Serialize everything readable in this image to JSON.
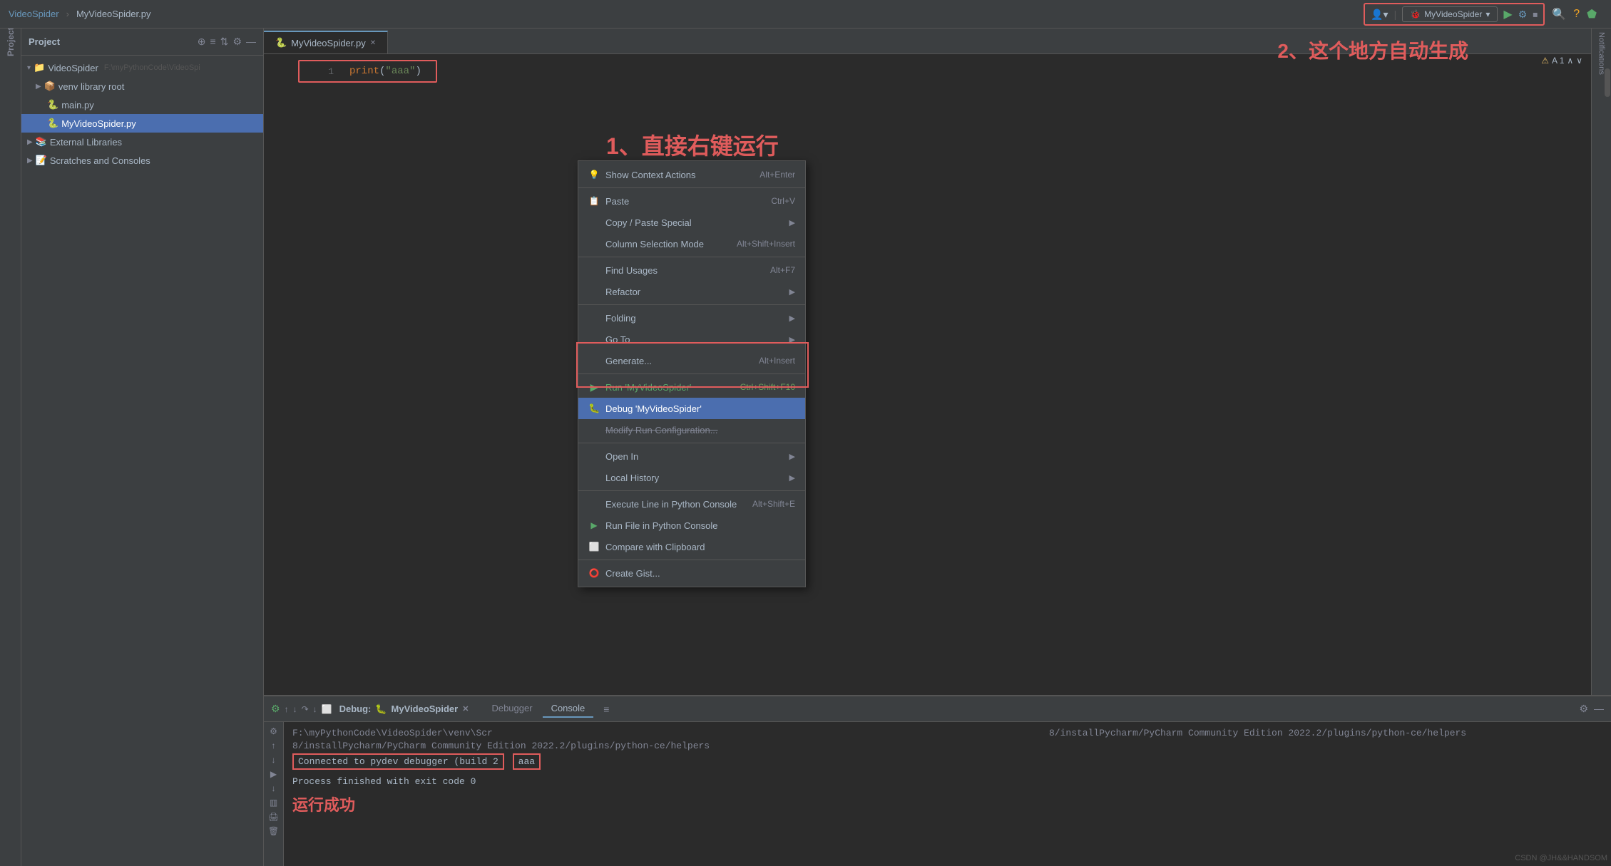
{
  "titlebar": {
    "project_name": "VideoSpider",
    "file_name": "MyVideoSpider.py",
    "run_config": "MyVideoSpider",
    "annotation_1": "1、直接右键运行",
    "annotation_2": "2、这个地方自动生成"
  },
  "sidebar": {
    "panel_title": "Project",
    "items": [
      {
        "label": "VideoSpider",
        "type": "folder",
        "indent": 0,
        "path": "F:\\myPythonCode\\VideoSpi"
      },
      {
        "label": "venv library root",
        "type": "venv",
        "indent": 1
      },
      {
        "label": "main.py",
        "type": "py",
        "indent": 2
      },
      {
        "label": "MyVideoSpider.py",
        "type": "py",
        "indent": 2,
        "selected": true
      },
      {
        "label": "External Libraries",
        "type": "folder",
        "indent": 0
      },
      {
        "label": "Scratches and Consoles",
        "type": "folder",
        "indent": 0
      }
    ]
  },
  "editor": {
    "tab_label": "MyVideoSpider.py",
    "code_line_1_num": "1",
    "code_line_1": "print(\"aaa\")"
  },
  "context_menu": {
    "items": [
      {
        "label": "Show Context Actions",
        "shortcut": "Alt+Enter",
        "icon": "💡",
        "has_arrow": false
      },
      {
        "label": "Paste",
        "shortcut": "Ctrl+V",
        "icon": "📋",
        "has_arrow": false
      },
      {
        "label": "Copy / Paste Special",
        "shortcut": "",
        "icon": "",
        "has_arrow": true
      },
      {
        "label": "Column Selection Mode",
        "shortcut": "Alt+Shift+Insert",
        "icon": "",
        "has_arrow": false
      },
      {
        "label": "Find Usages",
        "shortcut": "Alt+F7",
        "icon": "",
        "has_arrow": false
      },
      {
        "label": "Refactor",
        "shortcut": "",
        "icon": "",
        "has_arrow": true
      },
      {
        "label": "Folding",
        "shortcut": "",
        "icon": "",
        "has_arrow": true
      },
      {
        "label": "Go To",
        "shortcut": "",
        "icon": "",
        "has_arrow": true
      },
      {
        "label": "Generate...",
        "shortcut": "Alt+Insert",
        "icon": "",
        "has_arrow": false
      },
      {
        "label": "Run 'MyVideoSpider'",
        "shortcut": "Ctrl+Shift+F10",
        "icon": "▶",
        "type": "run"
      },
      {
        "label": "Debug 'MyVideoSpider'",
        "shortcut": "",
        "icon": "🐛",
        "type": "debug",
        "highlighted": true
      },
      {
        "label": "Modify Run Configuration...",
        "shortcut": "",
        "icon": "",
        "type": "modify"
      },
      {
        "label": "Open In",
        "shortcut": "",
        "icon": "",
        "has_arrow": true
      },
      {
        "label": "Local History",
        "shortcut": "",
        "icon": "",
        "has_arrow": true
      },
      {
        "label": "Execute Line in Python Console",
        "shortcut": "Alt+Shift+E",
        "icon": ""
      },
      {
        "label": "Run File in Python Console",
        "shortcut": "",
        "icon": "▶"
      },
      {
        "label": "Compare with Clipboard",
        "shortcut": "",
        "icon": ""
      },
      {
        "label": "Create Gist...",
        "shortcut": "",
        "icon": "⭕"
      }
    ]
  },
  "bottom_panel": {
    "title": "Debug:",
    "config_name": "MyVideoSpider",
    "tabs": [
      "Debugger",
      "Console"
    ],
    "active_tab": "Console",
    "console_lines": [
      "F:\\myPythonCode\\VideoSpider\\venv\\Scr",
      "8/installPycharm/PyCharm Community Edition 2022.2/plugins/python-ce/helpers",
      "Connected to pydev debugger (build 2",
      "aaa",
      "Process finished with exit code 0"
    ],
    "success_label": "运行成功"
  },
  "watermark": "CSDN @JH&&HANDSOM"
}
